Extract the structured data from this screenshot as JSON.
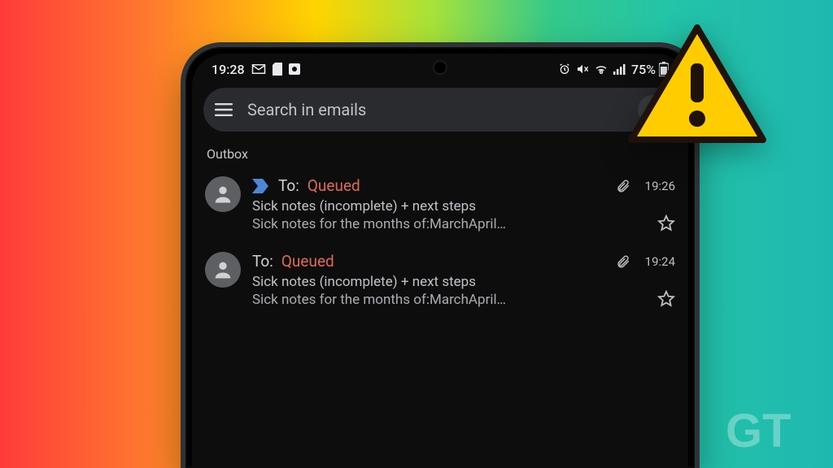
{
  "statusbar": {
    "time": "19:28",
    "battery_pct": "75%"
  },
  "search": {
    "placeholder": "Search in emails"
  },
  "section_label": "Outbox",
  "emails": [
    {
      "to_label": "To:",
      "status": "Queued",
      "time": "19:26",
      "subject": "Sick notes (incomplete) + next steps",
      "preview": "Sick notes for the months of:MarchApril…",
      "has_chevron": true
    },
    {
      "to_label": "To:",
      "status": "Queued",
      "time": "19:24",
      "subject": "Sick notes (incomplete) + next steps",
      "preview": "Sick notes for the months of:MarchApril…",
      "has_chevron": false
    }
  ],
  "watermark": "GT",
  "colors": {
    "queued": "#e26a55",
    "warning_fill": "#ffcc00",
    "warning_stroke": "#1f120b"
  }
}
